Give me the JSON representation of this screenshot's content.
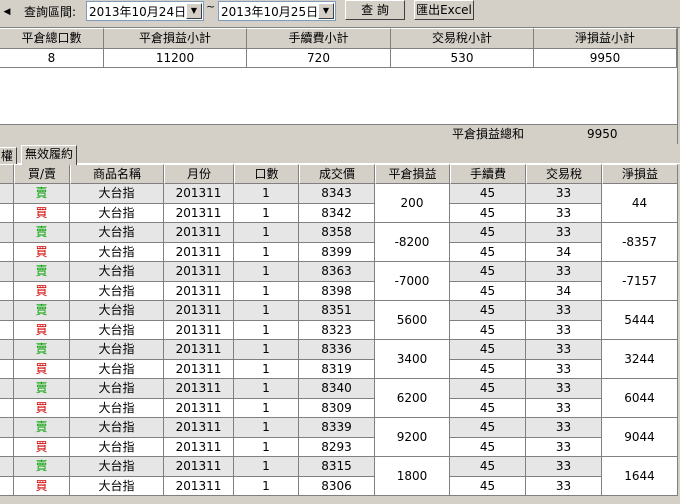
{
  "toolbar": {
    "arrow": "◀",
    "query_label": "查詢區間:",
    "date_from": "2013年10月24日",
    "tilde": "~",
    "date_to": "2013年10月25日",
    "query_button": "查 詢",
    "export_button": "匯出Excel"
  },
  "summary": {
    "headers": [
      "平倉總口數",
      "平倉損益小計",
      "手續費小計",
      "交易稅小計",
      "淨損益小計"
    ],
    "values": [
      "8",
      "11200",
      "720",
      "530",
      "9950"
    ],
    "total_label": "平倉損益總和",
    "total_value": "9950"
  },
  "tabs": [
    {
      "label": "權",
      "active": false
    },
    {
      "label": "無效履約",
      "active": true
    }
  ],
  "grid": {
    "headers": [
      "買/賣",
      "商品名稱",
      "月份",
      "口數",
      "成交價",
      "平倉損益",
      "手續費",
      "交易稅",
      "淨損益"
    ],
    "rows": [
      {
        "side": "賣",
        "product": "大台指",
        "month": "201311",
        "qty": "1",
        "price": "8343",
        "fee": "45",
        "tax": "33"
      },
      {
        "side": "買",
        "product": "大台指",
        "month": "201311",
        "qty": "1",
        "price": "8342",
        "fee": "45",
        "tax": "33"
      },
      {
        "side": "賣",
        "product": "大台指",
        "month": "201311",
        "qty": "1",
        "price": "8358",
        "fee": "45",
        "tax": "33"
      },
      {
        "side": "買",
        "product": "大台指",
        "month": "201311",
        "qty": "1",
        "price": "8399",
        "fee": "45",
        "tax": "34"
      },
      {
        "side": "賣",
        "product": "大台指",
        "month": "201311",
        "qty": "1",
        "price": "8363",
        "fee": "45",
        "tax": "33"
      },
      {
        "side": "買",
        "product": "大台指",
        "month": "201311",
        "qty": "1",
        "price": "8398",
        "fee": "45",
        "tax": "34"
      },
      {
        "side": "賣",
        "product": "大台指",
        "month": "201311",
        "qty": "1",
        "price": "8351",
        "fee": "45",
        "tax": "33"
      },
      {
        "side": "買",
        "product": "大台指",
        "month": "201311",
        "qty": "1",
        "price": "8323",
        "fee": "45",
        "tax": "33"
      },
      {
        "side": "賣",
        "product": "大台指",
        "month": "201311",
        "qty": "1",
        "price": "8336",
        "fee": "45",
        "tax": "33"
      },
      {
        "side": "買",
        "product": "大台指",
        "month": "201311",
        "qty": "1",
        "price": "8319",
        "fee": "45",
        "tax": "33"
      },
      {
        "side": "賣",
        "product": "大台指",
        "month": "201311",
        "qty": "1",
        "price": "8340",
        "fee": "45",
        "tax": "33"
      },
      {
        "side": "買",
        "product": "大台指",
        "month": "201311",
        "qty": "1",
        "price": "8309",
        "fee": "45",
        "tax": "33"
      },
      {
        "side": "賣",
        "product": "大台指",
        "month": "201311",
        "qty": "1",
        "price": "8339",
        "fee": "45",
        "tax": "33"
      },
      {
        "side": "買",
        "product": "大台指",
        "month": "201311",
        "qty": "1",
        "price": "8293",
        "fee": "45",
        "tax": "33"
      },
      {
        "side": "賣",
        "product": "大台指",
        "month": "201311",
        "qty": "1",
        "price": "8315",
        "fee": "45",
        "tax": "33"
      },
      {
        "side": "買",
        "product": "大台指",
        "month": "201311",
        "qty": "1",
        "price": "8306",
        "fee": "45",
        "tax": "33"
      }
    ],
    "pairs": [
      {
        "pnl": "200",
        "net": "44"
      },
      {
        "pnl": "-8200",
        "net": "-8357"
      },
      {
        "pnl": "-7000",
        "net": "-7157"
      },
      {
        "pnl": "5600",
        "net": "5444"
      },
      {
        "pnl": "3400",
        "net": "3244"
      },
      {
        "pnl": "6200",
        "net": "6044"
      },
      {
        "pnl": "9200",
        "net": "9044"
      },
      {
        "pnl": "1800",
        "net": "1644"
      }
    ]
  },
  "colors": {
    "sell": "#00a000",
    "buy": "#d00000",
    "chrome": "#d4d0c8"
  }
}
